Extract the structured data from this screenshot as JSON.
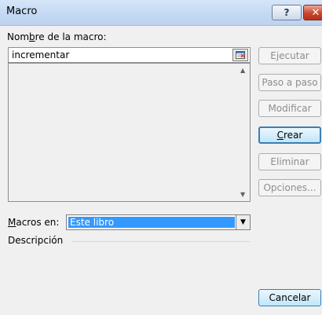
{
  "window": {
    "title": "Macro",
    "help_label": "?",
    "close_label": "✕"
  },
  "name_label": {
    "pre": "Nom",
    "accel": "b",
    "post": "re de la macro:"
  },
  "name_value": "incrementar",
  "buttons": {
    "run": "Ejecutar",
    "step": "Paso a paso",
    "edit": "Modificar",
    "create": {
      "accel": "C",
      "post": "rear"
    },
    "delete": "Eliminar",
    "options": "Opciones...",
    "cancel": "Cancelar"
  },
  "macros_in": {
    "label": {
      "accel": "M",
      "post": "acros en:"
    },
    "value": "Este libro"
  },
  "description_label": "Descripción",
  "icons": {
    "help": "help-icon",
    "close": "close-icon",
    "reference": "collapse-dialog-icon",
    "scroll_up": "scroll-up-arrow-icon",
    "scroll_down": "scroll-down-arrow-icon",
    "dropdown": "dropdown-arrow-icon"
  },
  "colors": {
    "title_bar": "#c4d9f2",
    "close_button": "#c8452c",
    "selection": "#3399ff",
    "default_button_border": "#3c7fb1"
  }
}
